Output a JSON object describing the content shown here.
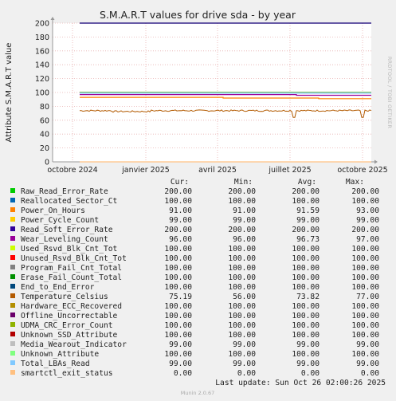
{
  "chart_data": {
    "type": "line",
    "title": "S.M.A.R.T values for drive sda - by year",
    "ylabel": "Attribute S.M.A.R.T value",
    "xlabel": "",
    "ylim": [
      0,
      200
    ],
    "yticks": [
      0,
      20,
      40,
      60,
      80,
      100,
      120,
      140,
      160,
      180,
      200
    ],
    "x_tick_labels": [
      "octobre 2024",
      "janvier 2025",
      "avril 2025",
      "juillet 2025",
      "octobre 2025"
    ],
    "grid": true,
    "watermark": "RRDTOOL / TOBI OETIKER",
    "legend_headers": [
      "Cur:",
      "Min:",
      "Avg:",
      "Max:"
    ],
    "series": [
      {
        "name": "Raw_Read_Error_Rate",
        "color": "#00cc00",
        "cur": "200.00",
        "min": "200.00",
        "avg": "200.00",
        "max": "200.00"
      },
      {
        "name": "Reallocated_Sector_Ct",
        "color": "#0066b3",
        "cur": "100.00",
        "min": "100.00",
        "avg": "100.00",
        "max": "100.00"
      },
      {
        "name": "Power_On_Hours",
        "color": "#ff8000",
        "cur": "91.00",
        "min": "91.00",
        "avg": "91.59",
        "max": "93.00"
      },
      {
        "name": "Power_Cycle_Count",
        "color": "#ffcc00",
        "cur": "99.00",
        "min": "99.00",
        "avg": "99.00",
        "max": "99.00"
      },
      {
        "name": "Read_Soft_Error_Rate",
        "color": "#330099",
        "cur": "200.00",
        "min": "200.00",
        "avg": "200.00",
        "max": "200.00"
      },
      {
        "name": "Wear_Leveling_Count",
        "color": "#990099",
        "cur": "96.00",
        "min": "96.00",
        "avg": "96.73",
        "max": "97.00"
      },
      {
        "name": "Used_Rsvd_Blk_Cnt_Tot",
        "color": "#ccff00",
        "cur": "100.00",
        "min": "100.00",
        "avg": "100.00",
        "max": "100.00"
      },
      {
        "name": "Unused_Rsvd_Blk_Cnt_Tot",
        "color": "#ff0000",
        "cur": "100.00",
        "min": "100.00",
        "avg": "100.00",
        "max": "100.00"
      },
      {
        "name": "Program_Fail_Cnt_Total",
        "color": "#808080",
        "cur": "100.00",
        "min": "100.00",
        "avg": "100.00",
        "max": "100.00"
      },
      {
        "name": "Erase_Fail_Count_Total",
        "color": "#008f00",
        "cur": "100.00",
        "min": "100.00",
        "avg": "100.00",
        "max": "100.00"
      },
      {
        "name": "End_to_End_Error",
        "color": "#00487d",
        "cur": "100.00",
        "min": "100.00",
        "avg": "100.00",
        "max": "100.00"
      },
      {
        "name": "Temperature_Celsius",
        "color": "#b35a00",
        "cur": "75.19",
        "min": "56.00",
        "avg": "73.82",
        "max": "77.00"
      },
      {
        "name": "Hardware_ECC_Recovered",
        "color": "#b38f00",
        "cur": "100.00",
        "min": "100.00",
        "avg": "100.00",
        "max": "100.00"
      },
      {
        "name": "Offline_Uncorrectable",
        "color": "#6b006b",
        "cur": "100.00",
        "min": "100.00",
        "avg": "100.00",
        "max": "100.00"
      },
      {
        "name": "UDMA_CRC_Error_Count",
        "color": "#8fb300",
        "cur": "100.00",
        "min": "100.00",
        "avg": "100.00",
        "max": "100.00"
      },
      {
        "name": "Unknown_SSD_Attribute",
        "color": "#b30000",
        "cur": "100.00",
        "min": "100.00",
        "avg": "100.00",
        "max": "100.00"
      },
      {
        "name": "Media_Wearout_Indicator",
        "color": "#bebebe",
        "cur": "99.00",
        "min": "99.00",
        "avg": "99.00",
        "max": "99.00"
      },
      {
        "name": "Unknown_Attribute",
        "color": "#80ff80",
        "cur": "100.00",
        "min": "100.00",
        "avg": "100.00",
        "max": "100.00"
      },
      {
        "name": "Total_LBAs_Read",
        "color": "#80c9ff",
        "cur": "99.00",
        "min": "99.00",
        "avg": "99.00",
        "max": "99.00"
      },
      {
        "name": "smartctl_exit_status",
        "color": "#ffc080",
        "cur": "0.00",
        "min": "0.00",
        "avg": "0.00",
        "max": "0.00"
      }
    ],
    "last_update": "Last update: Sun Oct 26 02:00:26 2025",
    "footer": "Munin 2.0.67"
  }
}
